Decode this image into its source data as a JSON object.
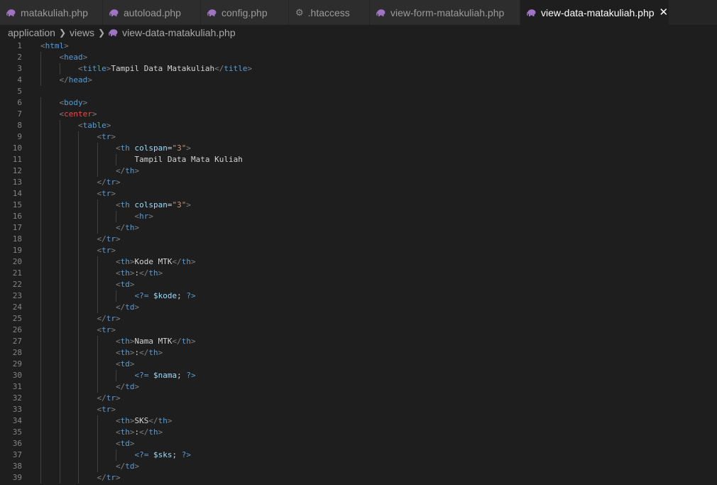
{
  "tabs": [
    {
      "label": "matakuliah.php",
      "icon": "php-elephant-icon",
      "active": false
    },
    {
      "label": "autoload.php",
      "icon": "php-elephant-icon",
      "active": false
    },
    {
      "label": "config.php",
      "icon": "php-elephant-icon",
      "active": false
    },
    {
      "label": ".htaccess",
      "icon": "gear-icon",
      "active": false
    },
    {
      "label": "view-form-matakuliah.php",
      "icon": "php-elephant-icon",
      "active": false
    },
    {
      "label": "view-data-matakuliah.php",
      "icon": "php-elephant-icon",
      "active": true
    }
  ],
  "tab_close_glyph": "✕",
  "breadcrumb": {
    "parts": [
      "application",
      "views"
    ],
    "file": "view-data-matakuliah.php"
  },
  "colors": {
    "php_icon": "#a074c4",
    "tag": "#569cd6",
    "center_tag": "#f44747",
    "attribute": "#9cdcfe",
    "string": "#ce9178"
  },
  "code_lines": [
    {
      "n": "1",
      "indent": 0,
      "tokens": [
        [
          "b",
          "<"
        ],
        [
          "tag",
          "html"
        ],
        [
          "b",
          ">"
        ]
      ]
    },
    {
      "n": "2",
      "indent": 1,
      "tokens": [
        [
          "b",
          "<"
        ],
        [
          "tag",
          "head"
        ],
        [
          "b",
          ">"
        ]
      ]
    },
    {
      "n": "3",
      "indent": 2,
      "tokens": [
        [
          "b",
          "<"
        ],
        [
          "tag",
          "title"
        ],
        [
          "b",
          ">"
        ],
        [
          "txt",
          "Tampil Data Matakuliah"
        ],
        [
          "b",
          "</"
        ],
        [
          "tag",
          "title"
        ],
        [
          "b",
          ">"
        ]
      ]
    },
    {
      "n": "4",
      "indent": 1,
      "tokens": [
        [
          "b",
          "</"
        ],
        [
          "tag",
          "head"
        ],
        [
          "b",
          ">"
        ]
      ]
    },
    {
      "n": "5",
      "indent": 0,
      "tokens": []
    },
    {
      "n": "6",
      "indent": 1,
      "tokens": [
        [
          "b",
          "<"
        ],
        [
          "tag",
          "body"
        ],
        [
          "b",
          ">"
        ]
      ]
    },
    {
      "n": "7",
      "indent": 1,
      "tokens": [
        [
          "b",
          "<"
        ],
        [
          "red",
          "center"
        ],
        [
          "b",
          ">"
        ]
      ]
    },
    {
      "n": "8",
      "indent": 2,
      "tokens": [
        [
          "b",
          "<"
        ],
        [
          "tag",
          "table"
        ],
        [
          "b",
          ">"
        ]
      ]
    },
    {
      "n": "9",
      "indent": 3,
      "tokens": [
        [
          "b",
          "<"
        ],
        [
          "tag",
          "tr"
        ],
        [
          "b",
          ">"
        ]
      ]
    },
    {
      "n": "10",
      "indent": 4,
      "tokens": [
        [
          "b",
          "<"
        ],
        [
          "tag",
          "th"
        ],
        [
          "txt",
          " "
        ],
        [
          "attr",
          "colspan"
        ],
        [
          "txt",
          "="
        ],
        [
          "str",
          "\"3\""
        ],
        [
          "b",
          ">"
        ]
      ]
    },
    {
      "n": "11",
      "indent": 5,
      "tokens": [
        [
          "txt",
          "Tampil Data Mata Kuliah"
        ]
      ]
    },
    {
      "n": "12",
      "indent": 4,
      "tokens": [
        [
          "b",
          "</"
        ],
        [
          "tag",
          "th"
        ],
        [
          "b",
          ">"
        ]
      ]
    },
    {
      "n": "13",
      "indent": 3,
      "tokens": [
        [
          "b",
          "</"
        ],
        [
          "tag",
          "tr"
        ],
        [
          "b",
          ">"
        ]
      ]
    },
    {
      "n": "14",
      "indent": 3,
      "tokens": [
        [
          "b",
          "<"
        ],
        [
          "tag",
          "tr"
        ],
        [
          "b",
          ">"
        ]
      ]
    },
    {
      "n": "15",
      "indent": 4,
      "tokens": [
        [
          "b",
          "<"
        ],
        [
          "tag",
          "th"
        ],
        [
          "txt",
          " "
        ],
        [
          "attr",
          "colspan"
        ],
        [
          "txt",
          "="
        ],
        [
          "str",
          "\"3\""
        ],
        [
          "b",
          ">"
        ]
      ]
    },
    {
      "n": "16",
      "indent": 5,
      "tokens": [
        [
          "b",
          "<"
        ],
        [
          "tag",
          "hr"
        ],
        [
          "b",
          ">"
        ]
      ]
    },
    {
      "n": "17",
      "indent": 4,
      "tokens": [
        [
          "b",
          "</"
        ],
        [
          "tag",
          "th"
        ],
        [
          "b",
          ">"
        ]
      ]
    },
    {
      "n": "18",
      "indent": 3,
      "tokens": [
        [
          "b",
          "</"
        ],
        [
          "tag",
          "tr"
        ],
        [
          "b",
          ">"
        ]
      ]
    },
    {
      "n": "19",
      "indent": 3,
      "tokens": [
        [
          "b",
          "<"
        ],
        [
          "tag",
          "tr"
        ],
        [
          "b",
          ">"
        ]
      ]
    },
    {
      "n": "20",
      "indent": 4,
      "tokens": [
        [
          "b",
          "<"
        ],
        [
          "tag",
          "th"
        ],
        [
          "b",
          ">"
        ],
        [
          "txt",
          "Kode MTK"
        ],
        [
          "b",
          "</"
        ],
        [
          "tag",
          "th"
        ],
        [
          "b",
          ">"
        ]
      ]
    },
    {
      "n": "21",
      "indent": 4,
      "tokens": [
        [
          "b",
          "<"
        ],
        [
          "tag",
          "th"
        ],
        [
          "b",
          ">"
        ],
        [
          "txt",
          ":"
        ],
        [
          "b",
          "</"
        ],
        [
          "tag",
          "th"
        ],
        [
          "b",
          ">"
        ]
      ]
    },
    {
      "n": "22",
      "indent": 4,
      "tokens": [
        [
          "b",
          "<"
        ],
        [
          "tag",
          "td"
        ],
        [
          "b",
          ">"
        ]
      ]
    },
    {
      "n": "23",
      "indent": 5,
      "tokens": [
        [
          "php",
          "<?="
        ],
        [
          "txt",
          " "
        ],
        [
          "var",
          "$kode"
        ],
        [
          "txt",
          "; "
        ],
        [
          "php",
          "?>"
        ]
      ]
    },
    {
      "n": "24",
      "indent": 4,
      "tokens": [
        [
          "b",
          "</"
        ],
        [
          "tag",
          "td"
        ],
        [
          "b",
          ">"
        ]
      ]
    },
    {
      "n": "25",
      "indent": 3,
      "tokens": [
        [
          "b",
          "</"
        ],
        [
          "tag",
          "tr"
        ],
        [
          "b",
          ">"
        ]
      ]
    },
    {
      "n": "26",
      "indent": 3,
      "tokens": [
        [
          "b",
          "<"
        ],
        [
          "tag",
          "tr"
        ],
        [
          "b",
          ">"
        ]
      ]
    },
    {
      "n": "27",
      "indent": 4,
      "tokens": [
        [
          "b",
          "<"
        ],
        [
          "tag",
          "th"
        ],
        [
          "b",
          ">"
        ],
        [
          "txt",
          "Nama MTK"
        ],
        [
          "b",
          "</"
        ],
        [
          "tag",
          "th"
        ],
        [
          "b",
          ">"
        ]
      ]
    },
    {
      "n": "28",
      "indent": 4,
      "tokens": [
        [
          "b",
          "<"
        ],
        [
          "tag",
          "th"
        ],
        [
          "b",
          ">"
        ],
        [
          "txt",
          ":"
        ],
        [
          "b",
          "</"
        ],
        [
          "tag",
          "th"
        ],
        [
          "b",
          ">"
        ]
      ]
    },
    {
      "n": "29",
      "indent": 4,
      "tokens": [
        [
          "b",
          "<"
        ],
        [
          "tag",
          "td"
        ],
        [
          "b",
          ">"
        ]
      ]
    },
    {
      "n": "30",
      "indent": 5,
      "tokens": [
        [
          "php",
          "<?="
        ],
        [
          "txt",
          " "
        ],
        [
          "var",
          "$nama"
        ],
        [
          "txt",
          "; "
        ],
        [
          "php",
          "?>"
        ]
      ]
    },
    {
      "n": "31",
      "indent": 4,
      "tokens": [
        [
          "b",
          "</"
        ],
        [
          "tag",
          "td"
        ],
        [
          "b",
          ">"
        ]
      ]
    },
    {
      "n": "32",
      "indent": 3,
      "tokens": [
        [
          "b",
          "</"
        ],
        [
          "tag",
          "tr"
        ],
        [
          "b",
          ">"
        ]
      ]
    },
    {
      "n": "33",
      "indent": 3,
      "tokens": [
        [
          "b",
          "<"
        ],
        [
          "tag",
          "tr"
        ],
        [
          "b",
          ">"
        ]
      ]
    },
    {
      "n": "34",
      "indent": 4,
      "tokens": [
        [
          "b",
          "<"
        ],
        [
          "tag",
          "th"
        ],
        [
          "b",
          ">"
        ],
        [
          "txt",
          "SKS"
        ],
        [
          "b",
          "</"
        ],
        [
          "tag",
          "th"
        ],
        [
          "b",
          ">"
        ]
      ]
    },
    {
      "n": "35",
      "indent": 4,
      "tokens": [
        [
          "b",
          "<"
        ],
        [
          "tag",
          "th"
        ],
        [
          "b",
          ">"
        ],
        [
          "txt",
          ":"
        ],
        [
          "b",
          "</"
        ],
        [
          "tag",
          "th"
        ],
        [
          "b",
          ">"
        ]
      ]
    },
    {
      "n": "36",
      "indent": 4,
      "tokens": [
        [
          "b",
          "<"
        ],
        [
          "tag",
          "td"
        ],
        [
          "b",
          ">"
        ]
      ]
    },
    {
      "n": "37",
      "indent": 5,
      "tokens": [
        [
          "php",
          "<?="
        ],
        [
          "txt",
          " "
        ],
        [
          "var",
          "$sks"
        ],
        [
          "txt",
          "; "
        ],
        [
          "php",
          "?>"
        ]
      ]
    },
    {
      "n": "38",
      "indent": 4,
      "tokens": [
        [
          "b",
          "</"
        ],
        [
          "tag",
          "td"
        ],
        [
          "b",
          ">"
        ]
      ]
    },
    {
      "n": "39",
      "indent": 3,
      "tokens": [
        [
          "b",
          "</"
        ],
        [
          "tag",
          "tr"
        ],
        [
          "b",
          ">"
        ]
      ]
    }
  ]
}
